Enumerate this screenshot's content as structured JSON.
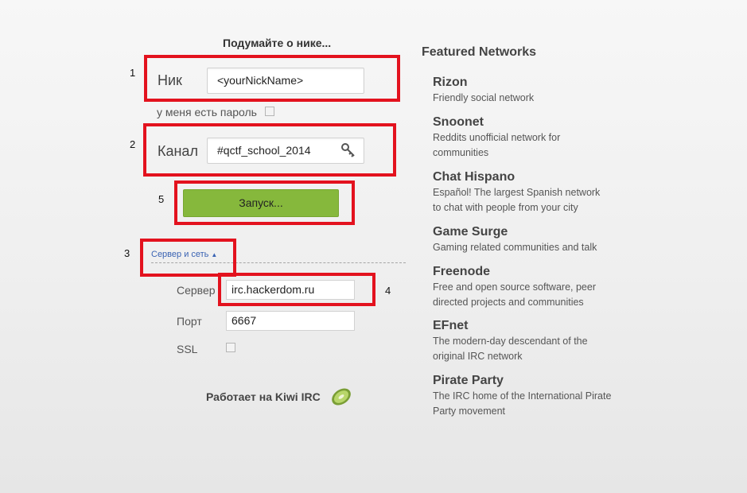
{
  "header": "Подумайте о нике...",
  "nick": {
    "label": "Ник",
    "value": "<yourNickName>"
  },
  "password_checkbox_label": "у меня есть пароль",
  "channel": {
    "label": "Канал",
    "value": "#qctf_school_2014"
  },
  "launch_button": "Запуск...",
  "server_toggle": "Сервер и сеть",
  "server": {
    "label": "Сервер",
    "value": "irc.hackerdom.ru"
  },
  "port": {
    "label": "Порт",
    "value": "6667"
  },
  "ssl": {
    "label": "SSL"
  },
  "powered_by": "Работает на Kiwi IRC",
  "annotations": [
    "1",
    "2",
    "3",
    "4",
    "5"
  ],
  "featured": {
    "title": "Featured Networks",
    "networks": [
      {
        "name": "Rizon",
        "desc": [
          "Friendly social network"
        ]
      },
      {
        "name": "Snoonet",
        "desc": [
          "Reddits unofficial network for",
          "communities"
        ]
      },
      {
        "name": "Chat Hispano",
        "desc": [
          "Español! The largest Spanish network",
          "to chat with people from your city"
        ]
      },
      {
        "name": "Game Surge",
        "desc": [
          "Gaming related communities and talk"
        ]
      },
      {
        "name": "Freenode",
        "desc": [
          "Free and open source software, peer",
          "directed projects and communities"
        ]
      },
      {
        "name": "EFnet",
        "desc": [
          "The modern-day descendant of the",
          "original IRC network"
        ]
      },
      {
        "name": "Pirate Party",
        "desc": [
          "The IRC home of the International Pirate",
          "Party movement"
        ]
      }
    ]
  },
  "colors": {
    "accent_green": "#86b83c",
    "annotation_red": "#e3121e",
    "link_blue": "#3a63b3"
  }
}
